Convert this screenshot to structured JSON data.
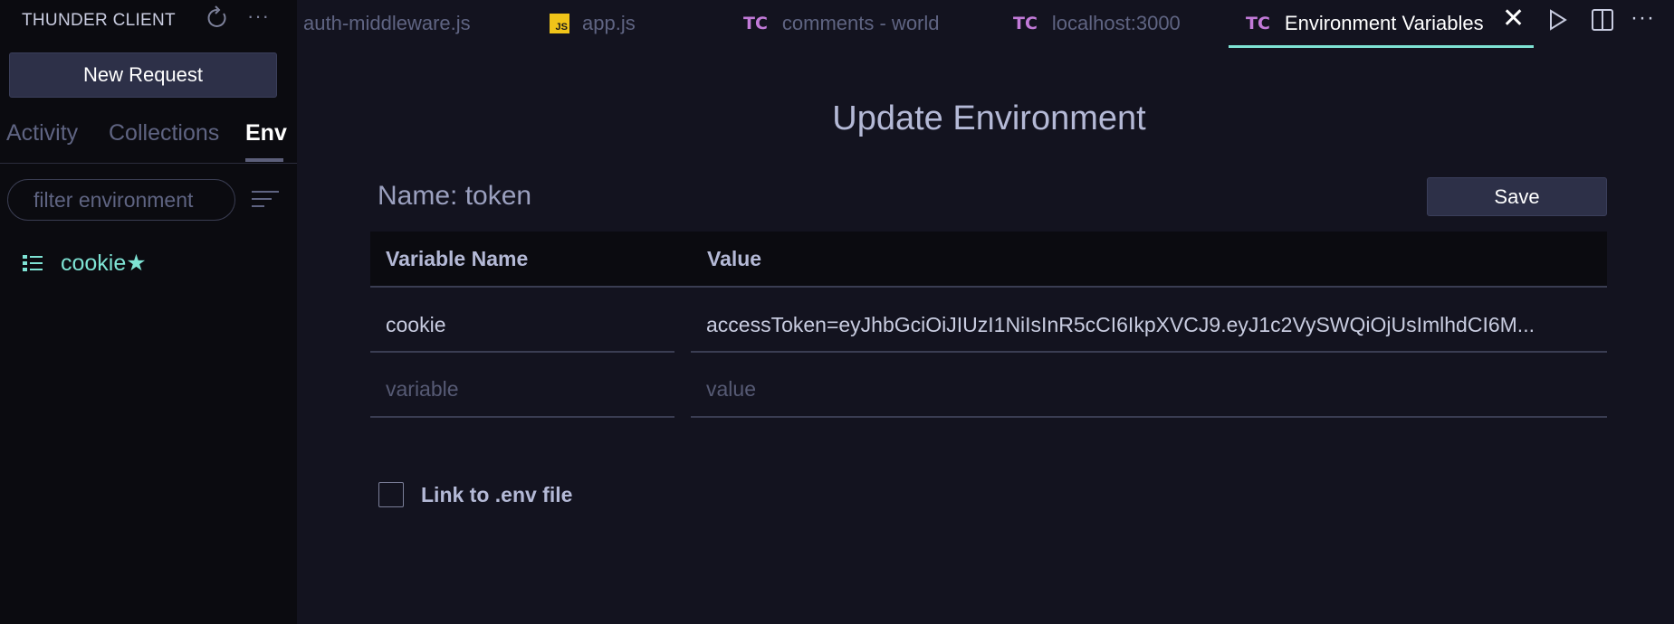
{
  "sidebar": {
    "title": "THUNDER CLIENT",
    "new_request_label": "New Request",
    "tabs": [
      {
        "label": "Activity"
      },
      {
        "label": "Collections"
      },
      {
        "label": "Env",
        "active": true
      }
    ],
    "filter_placeholder": "filter environment",
    "environments": [
      {
        "name": "cookie★"
      }
    ]
  },
  "editor_tabs": [
    {
      "label": "auth-middleware.js",
      "icon": "none"
    },
    {
      "label": "app.js",
      "icon": "js-file-icon",
      "badge": "JS"
    },
    {
      "label": "comments - world",
      "icon": "thunder-client-icon",
      "badge": "TC"
    },
    {
      "label": "localhost:3000",
      "icon": "thunder-client-icon",
      "badge": "TC"
    },
    {
      "label": "Environment Variables",
      "icon": "thunder-client-icon",
      "badge": "TC",
      "active": true
    }
  ],
  "main": {
    "title": "Update Environment",
    "env_name_label": "Name: token",
    "save_label": "Save",
    "table": {
      "headers": [
        "Variable Name",
        "Value"
      ],
      "rows": [
        {
          "variable": "cookie",
          "value": "accessToken=eyJhbGciOiJIUzI1NiIsInR5cCI6IkpXVCJ9.eyJ1c2VySWQiOjUsImlhdCI6M..."
        }
      ],
      "new_row": {
        "variable_placeholder": "variable",
        "value_placeholder": "value"
      }
    },
    "link_env_label": "Link to .env file"
  },
  "colors": {
    "accent": "#7ee3d4",
    "tc_badge": "#c27ad8",
    "js_badge": "#f0c419"
  }
}
